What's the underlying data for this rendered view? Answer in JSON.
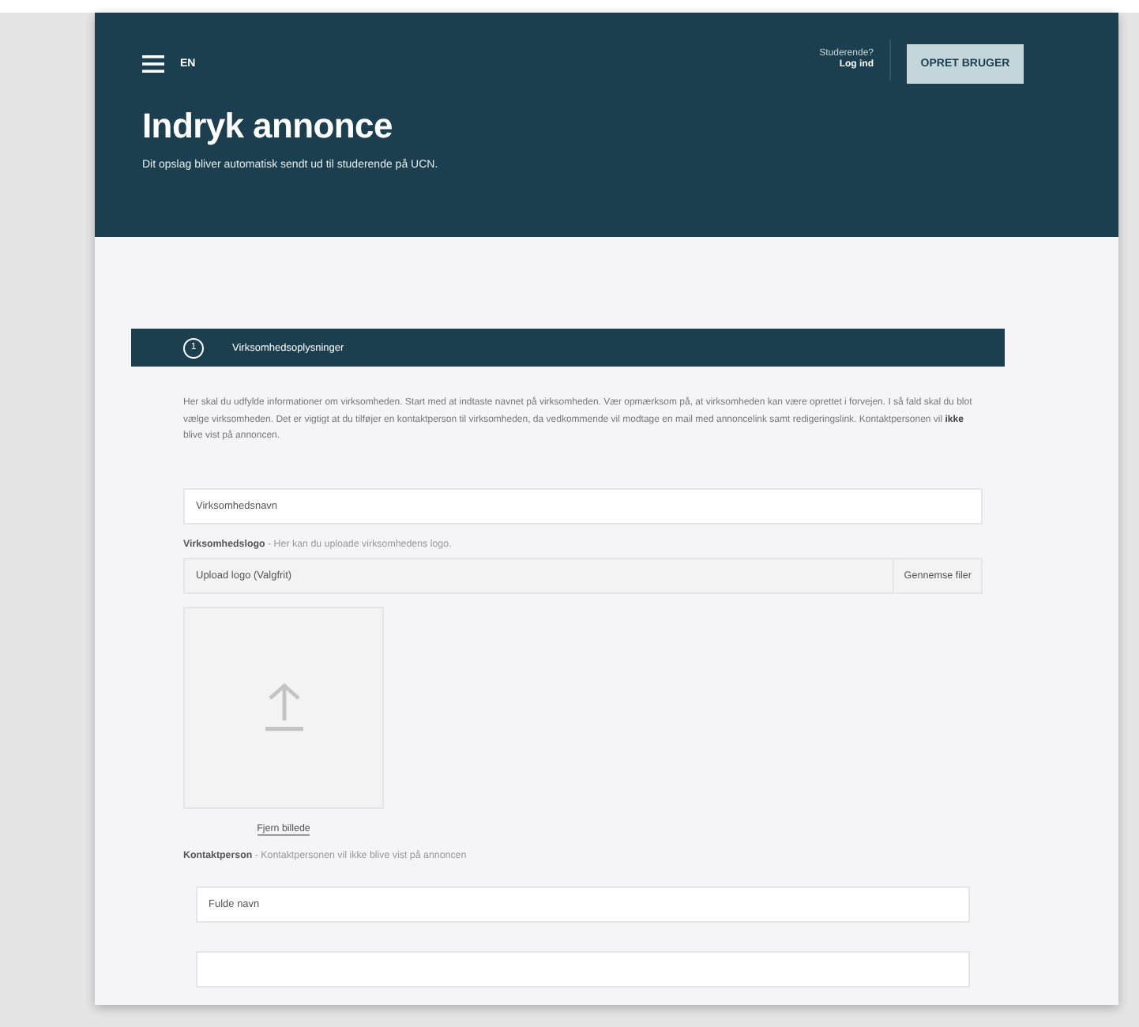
{
  "header": {
    "language": "EN",
    "login_prompt": "Studerende?",
    "login_link": "Log ind",
    "create_button": "OPRET BRUGER",
    "title": "Indryk annonce",
    "subtitle": "Dit opslag bliver automatisk sendt ud til studerende på UCN."
  },
  "section": {
    "number": "1",
    "title": "Virksomhedsoplysninger",
    "description": "Her skal du udfylde informationer om virksomheden. Start med at indtaste navnet på virksomheden. Vær opmærksom på, at virksomheden kan være oprettet i forvejen. I så fald skal du blot vælge virksomheden. Det er vigtigt at du tilføjer en kontaktperson til virksomheden, da vedkommende vil modtage en mail med annoncelink samt redigeringslink. Kontaktpersonen vil **ikke** blive vist på annoncen."
  },
  "company_name": {
    "placeholder": "Virksomhedsnavn"
  },
  "logo": {
    "label": "**Virksomhedslogo** - Her kan du uploade virksomhedens logo.",
    "placeholder": "Upload logo (Valgfrit)",
    "browse_button": "Gennemse filer",
    "remove_link": "Fjern billede"
  },
  "contact": {
    "label": "**Kontaktperson** - Kontaktpersonen vil ikke blive vist på annoncen",
    "fields": [
      {
        "kind": "text",
        "placeholder": "Fulde navn"
      },
      {
        "kind": "text"
      }
    ]
  }
}
